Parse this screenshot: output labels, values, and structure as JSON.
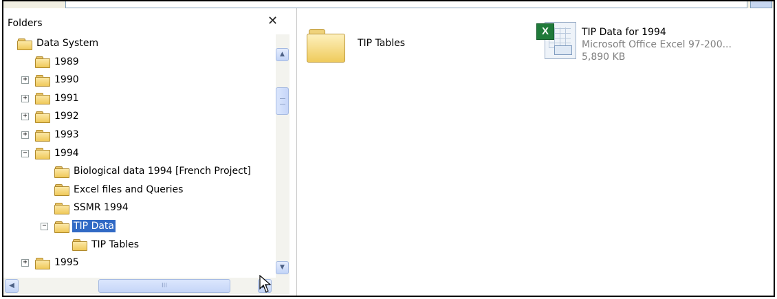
{
  "folders_panel": {
    "title": "Folders",
    "close_glyph": "✕",
    "tree": [
      {
        "label": "Data System",
        "expander": "",
        "level": 0
      },
      {
        "label": "1989",
        "expander": "",
        "level": 1
      },
      {
        "label": "1990",
        "expander": "+",
        "level": 1
      },
      {
        "label": "1991",
        "expander": "+",
        "level": 1
      },
      {
        "label": "1992",
        "expander": "+",
        "level": 1
      },
      {
        "label": "1993",
        "expander": "+",
        "level": 1
      },
      {
        "label": "1994",
        "expander": "−",
        "level": 1
      },
      {
        "label": "Biological data 1994 [French Project]",
        "expander": "",
        "level": 2
      },
      {
        "label": "Excel files and Queries",
        "expander": "",
        "level": 2
      },
      {
        "label": "SSMR 1994",
        "expander": "",
        "level": 2
      },
      {
        "label": "TIP Data",
        "expander": "−",
        "level": 2,
        "selected": true
      },
      {
        "label": "TIP Tables",
        "expander": "",
        "level": 3
      },
      {
        "label": "1995",
        "expander": "+",
        "level": 1
      }
    ],
    "scroll_up_glyph": "▲",
    "scroll_down_glyph": "▼",
    "scroll_left_glyph": "◀",
    "scroll_right_glyph": "▶",
    "hthumb_grip": "III"
  },
  "content": {
    "items": [
      {
        "name": "TIP Tables",
        "icon": "folder-icon"
      },
      {
        "name": "TIP Data for 1994",
        "type": "Microsoft Office Excel 97-200...",
        "size": "5,890 KB",
        "icon": "excel-file-icon",
        "logo_letter": "X"
      }
    ]
  },
  "colors": {
    "selection": "#316ac5"
  }
}
